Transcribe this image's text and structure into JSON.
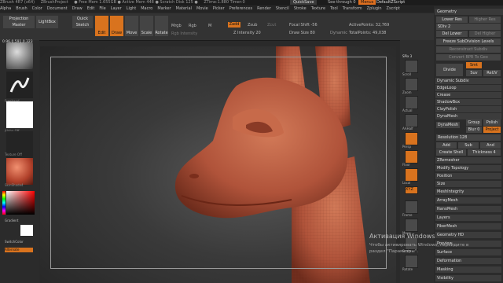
{
  "title_bar": {
    "items": [
      "ZBrush 4R7 (x64)",
      "ZBrushProject",
      "● Free Mem 1.655GB ● Active Mem 448 ● Scratch Disk 125 ●",
      "ZTime:1.880 Timer:0"
    ],
    "quicksave": "QuickSave",
    "see_through": "See-through 0",
    "menus": "Menus",
    "default_zscript": "DefaultZScript"
  },
  "menubar": [
    "Alpha",
    "Brush",
    "Color",
    "Document",
    "Draw",
    "Edit",
    "File",
    "Layer",
    "Light",
    "Macro",
    "Marker",
    "Material",
    "Movie",
    "Picker",
    "Preferences",
    "Render",
    "Stencil",
    "Stroke",
    "Texture",
    "Tool",
    "Transform",
    "Zplugin",
    "Zscript"
  ],
  "toolbar": {
    "projection_master": "Projection Master",
    "lightbox": "LightBox",
    "quick_sketch": "Quick Sketch",
    "edit": "Edit",
    "draw": "Draw",
    "move": "Move",
    "scale": "Scale",
    "rotate": "Rotate",
    "mrgb": "Mrgb",
    "rgb": "Rgb",
    "m": "M",
    "rgb_intensity": "Rgb Intensity",
    "zadd": "Zadd",
    "zsub": "Zsub",
    "zcut": "Zcut",
    "z_intensity": "Z Intensity 20",
    "focal_shift": "Focal Shift -56",
    "draw_size": "Draw Size 80",
    "dynamic": "Dynamic",
    "active_points": "ActivePoints: 32,769",
    "total_points": "TotalPoints: 49,038"
  },
  "coords": "0.96,0.591,0.323",
  "left_tray": {
    "tile1_label": "",
    "tile2_label": "Freehand",
    "tile3_label": "Alpha Off",
    "tile4_label": "Texture Off",
    "tile5_label": "SkinShade4",
    "gradient": "Gradient",
    "switch_color": "SwitchColor",
    "alternate": "Alternate"
  },
  "right_tray": {
    "spix": "SPix 3",
    "scroll": "Scroll",
    "zoom": "Zoom",
    "actual": "Actual",
    "aahalf": "AAHalf",
    "persp": "Persp",
    "floor": "Floor",
    "local": "Local",
    "xyz": "XYZ",
    "frame": "Frame",
    "move": "Move",
    "scale": "Scale",
    "rotate": "Rotate"
  },
  "geometry_panel": {
    "header": "Geometry",
    "lower_res": "Lower Res",
    "higher_res": "Higher Res",
    "sdiv": "SDiv 2",
    "del_lower": "Del Lower",
    "del_higher": "Del Higher",
    "freeze": "Freeze SubDivision Levels",
    "reconstruct": "Reconstruct Subdiv",
    "convert_bpr": "Convert BPR To Geo",
    "divide": "Divide",
    "smt": "Smt",
    "suv": "Suv",
    "reuv": "ReUV",
    "sections": [
      "Dynamic Subdiv",
      "EdgeLoop",
      "Crease",
      "ShadowBox",
      "ClayPolish",
      "DynaMesh"
    ],
    "dynamesh_btn": "DynaMesh",
    "group": "Group",
    "polish": "Polish",
    "blur": "Blur 0",
    "project": "Project",
    "resolution": "Resolution 128",
    "add": "Add",
    "sub": "Sub",
    "and": "And",
    "create_shell": "Create Shell",
    "thickness": "Thickness 4",
    "sections2": [
      "ZRemesher",
      "Modify Topology",
      "Position",
      "Size",
      "MeshIntegrity"
    ],
    "sections3": [
      "ArrayMesh",
      "NanoMesh",
      "Layers",
      "FiberMesh",
      "Geometry HD",
      "Preview",
      "Surface",
      "Deformation",
      "Masking",
      "Visibility"
    ]
  },
  "watermark": {
    "line1": "Активация Windows",
    "line2": "Чтобы активировать Windows, перейдите в раздел \"Параметры\"."
  },
  "colors": {
    "accent": "#d9731e",
    "model": "#b85a3a"
  }
}
